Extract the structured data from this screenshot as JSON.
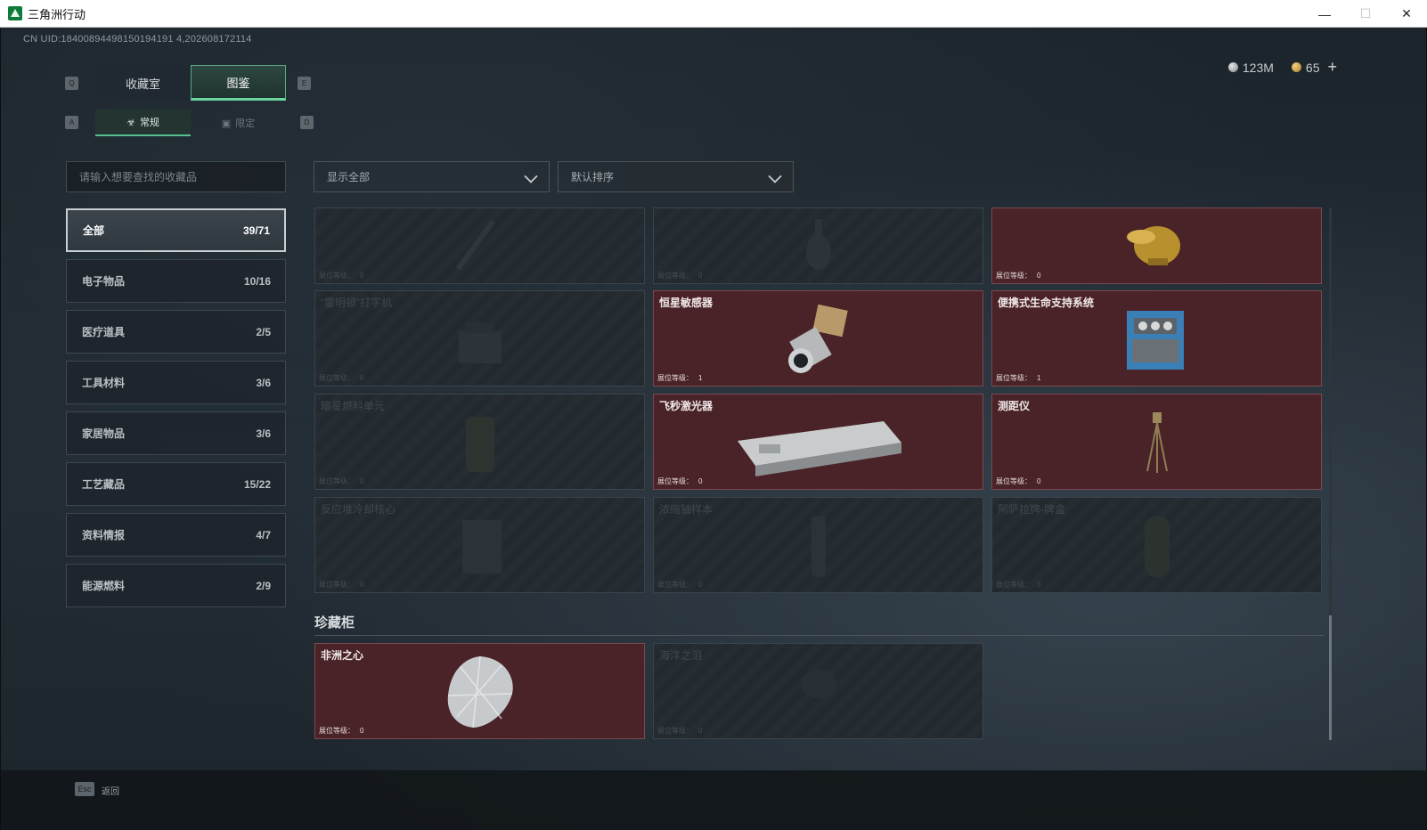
{
  "window": {
    "title": "三角洲行动",
    "minimize": "—",
    "maximize": "☐",
    "close": "✕"
  },
  "uid": "CN UID:18400894498150194191 4,202608172114",
  "currency": {
    "silver": "123M",
    "gold": "65",
    "add": "+"
  },
  "keys": {
    "prev_tab": "Q",
    "next_tab": "E",
    "prev_sub": "A",
    "next_sub": "D",
    "esc": "Esc"
  },
  "main_tabs": [
    {
      "label": "收藏室",
      "active": false
    },
    {
      "label": "图鉴",
      "active": true
    }
  ],
  "sub_tabs": [
    {
      "label": "常规",
      "icon": "bottle-icon",
      "active": true
    },
    {
      "label": "限定",
      "icon": "image-icon",
      "active": false
    }
  ],
  "search": {
    "placeholder": "请输入想要查找的收藏品"
  },
  "filters": {
    "display": "显示全部",
    "sort": "默认排序"
  },
  "categories": [
    {
      "label": "全部",
      "count": "39/71",
      "active": true
    },
    {
      "label": "电子物品",
      "count": "10/16"
    },
    {
      "label": "医疗道具",
      "count": "2/5"
    },
    {
      "label": "工具材料",
      "count": "3/6"
    },
    {
      "label": "家居物品",
      "count": "3/6"
    },
    {
      "label": "工艺藏品",
      "count": "15/22"
    },
    {
      "label": "资料情报",
      "count": "4/7"
    },
    {
      "label": "能源燃料",
      "count": "2/9"
    }
  ],
  "level_label": "展位等级：",
  "items": [
    {
      "name": "",
      "level": "0",
      "owned": false,
      "icon": "syringe-icon"
    },
    {
      "name": "",
      "level": "0",
      "owned": false,
      "icon": "vase-icon"
    },
    {
      "name": "",
      "level": "0",
      "owned": true,
      "icon": "golden-idol-icon"
    },
    {
      "name": "“雷明顿”打字机",
      "level": "0",
      "owned": false,
      "icon": "typewriter-icon"
    },
    {
      "name": "恒星敏感器",
      "level": "1",
      "owned": true,
      "icon": "star-sensor-icon"
    },
    {
      "name": "便携式生命支持系统",
      "level": "1",
      "owned": true,
      "icon": "life-support-icon"
    },
    {
      "name": "暗星燃料单元",
      "level": "0",
      "owned": false,
      "icon": "fuel-cell-icon"
    },
    {
      "name": "飞秒激光器",
      "level": "0",
      "owned": true,
      "icon": "laser-icon"
    },
    {
      "name": "测距仪",
      "level": "0",
      "owned": true,
      "icon": "rangefinder-icon"
    },
    {
      "name": "反应堆冷却核心",
      "level": "0",
      "owned": false,
      "icon": "reactor-core-icon"
    },
    {
      "name": "浓缩铀样本",
      "level": "0",
      "owned": false,
      "icon": "uranium-icon"
    },
    {
      "name": "阿萨拉牌-牌盒",
      "level": "0",
      "owned": false,
      "icon": "card-box-icon"
    }
  ],
  "treasure_section": {
    "title": "珍藏柜",
    "items": [
      {
        "name": "非洲之心",
        "level": "0",
        "owned": true,
        "icon": "diamond-icon"
      },
      {
        "name": "海洋之泪",
        "level": "0",
        "owned": false,
        "icon": "gem-icon"
      }
    ]
  },
  "footer": {
    "back": "返回"
  },
  "colors": {
    "owned_bg": "#4a2328",
    "accent": "#6bd6a0"
  }
}
